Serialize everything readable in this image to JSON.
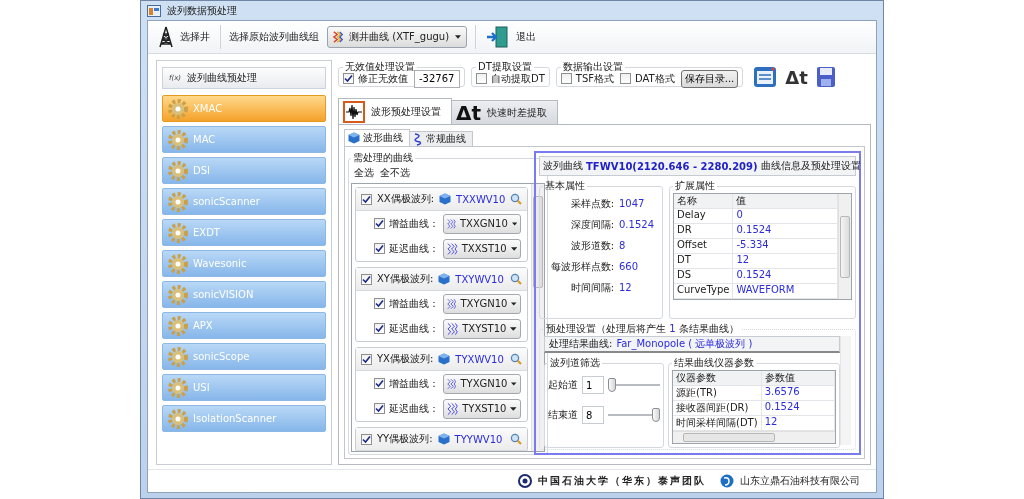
{
  "window": {
    "title": "波列数据预处理"
  },
  "toolbar": {
    "select_well": "选择井",
    "group_label": "选择原始波列曲线组",
    "group_combo": "测井曲线 (XTF_gugu)",
    "exit": "退出"
  },
  "sidebar": {
    "title_icon": "f(x)",
    "title": "波列曲线预处理",
    "items": [
      {
        "label": "XMAC",
        "selected": true
      },
      {
        "label": "MAC",
        "selected": false
      },
      {
        "label": "DSI",
        "selected": false
      },
      {
        "label": "sonicScanner",
        "selected": false
      },
      {
        "label": "EXDT",
        "selected": false
      },
      {
        "label": "Wavesonic",
        "selected": false
      },
      {
        "label": "sonicVISION",
        "selected": false
      },
      {
        "label": "APX",
        "selected": false
      },
      {
        "label": "sonicScope",
        "selected": false
      },
      {
        "label": "USI",
        "selected": false
      },
      {
        "label": "IsolationScanner",
        "selected": false
      }
    ]
  },
  "settings": {
    "invalid": {
      "title": "无效值处理设置",
      "checkbox": {
        "label": "修正无效值",
        "checked": true
      },
      "value": "-32767"
    },
    "dt": {
      "title": "DT提取设置",
      "checkbox": {
        "label": "自动提取DT",
        "checked": false
      }
    },
    "output": {
      "title": "数据输出设置",
      "checkboxes": [
        {
          "label": "TSF格式",
          "checked": false
        },
        {
          "label": "DAT格式",
          "checked": false
        }
      ],
      "button": "保存目录..."
    },
    "dt_tool": "Δt"
  },
  "tabs": [
    {
      "kind": "wave",
      "label": "波形预处理设置",
      "selected": true
    },
    {
      "kind": "delta",
      "symbol": "Δt",
      "label": "快速时差提取",
      "selected": false
    }
  ],
  "subtabs": [
    {
      "kind": "cube",
      "label": "波形曲线",
      "selected": true
    },
    {
      "kind": "curve",
      "label": "常规曲线",
      "selected": false
    }
  ],
  "curves": {
    "title": "需处理的曲线",
    "select_all": "全选",
    "select_none": "全不选",
    "groups": [
      {
        "label": "XX偶极波列:",
        "checked": true,
        "curve": "TXXWV10",
        "rows": [
          {
            "label": "增益曲线：",
            "checked": true,
            "value": "TXXGN10"
          },
          {
            "label": "延迟曲线：",
            "checked": true,
            "value": "TXXST10"
          }
        ]
      },
      {
        "label": "XY偶极波列:",
        "checked": true,
        "curve": "TXYWV10",
        "rows": [
          {
            "label": "增益曲线：",
            "checked": true,
            "value": "TXYGN10"
          },
          {
            "label": "延迟曲线：",
            "checked": true,
            "value": "TXYST10"
          }
        ]
      },
      {
        "label": "YX偶极波列:",
        "checked": true,
        "curve": "TYXWV10",
        "rows": [
          {
            "label": "增益曲线：",
            "checked": true,
            "value": "TYXGN10"
          },
          {
            "label": "延迟曲线：",
            "checked": true,
            "value": "TYXST10"
          }
        ]
      },
      {
        "label": "YY偶极波列:",
        "checked": true,
        "curve": "TYYWV10"
      }
    ]
  },
  "info": {
    "header_prefix": "波列曲线",
    "header_curve": "TFWV10(2120.646 - 2280.209)",
    "header_suffix": "曲线信息及预处理设置",
    "basic": {
      "title": "基本属性",
      "fields": [
        {
          "label": "采样点数:",
          "value": "1047"
        },
        {
          "label": "深度间隔:",
          "value": "0.1524"
        },
        {
          "label": "波形道数:",
          "value": "8"
        },
        {
          "label": "每波形样点数:",
          "value": "660"
        },
        {
          "label": "时间间隔:",
          "value": "12"
        }
      ]
    },
    "extended": {
      "title": "扩展属性",
      "columns": [
        "名称",
        "值"
      ],
      "rows": [
        [
          "Delay",
          "0"
        ],
        [
          "DR",
          "0.1524"
        ],
        [
          "Offset",
          "-5.334"
        ],
        [
          "DT",
          "12"
        ],
        [
          "DS",
          "0.1524"
        ],
        [
          "CurveType",
          "WAVEFORM"
        ]
      ]
    },
    "preprocess": {
      "title_prefix": "预处理设置（处理后将产生",
      "count": "1",
      "title_suffix": "条结果曲线）",
      "result_label": "处理结果曲线:",
      "result_value": "Far_Monopole ( 远单极波列 )",
      "filter": {
        "title": "波列道筛选",
        "channels": [
          {
            "label": "起始道",
            "value": "1",
            "level": 0
          },
          {
            "label": "结束道",
            "value": "8",
            "level": 1
          }
        ]
      },
      "params": {
        "title": "结果曲线仪器参数",
        "columns": [
          "仪器参数",
          "参数值"
        ],
        "rows": [
          [
            "源距(TR)",
            "3.6576"
          ],
          [
            "接收器间距(DR)",
            "0.1524"
          ],
          [
            "时间采样间隔(DT)",
            "12"
          ]
        ]
      }
    }
  },
  "footer": {
    "team": "中国石油大学（华东）泰声团队",
    "company": "山东立鼎石油科技有限公司"
  }
}
